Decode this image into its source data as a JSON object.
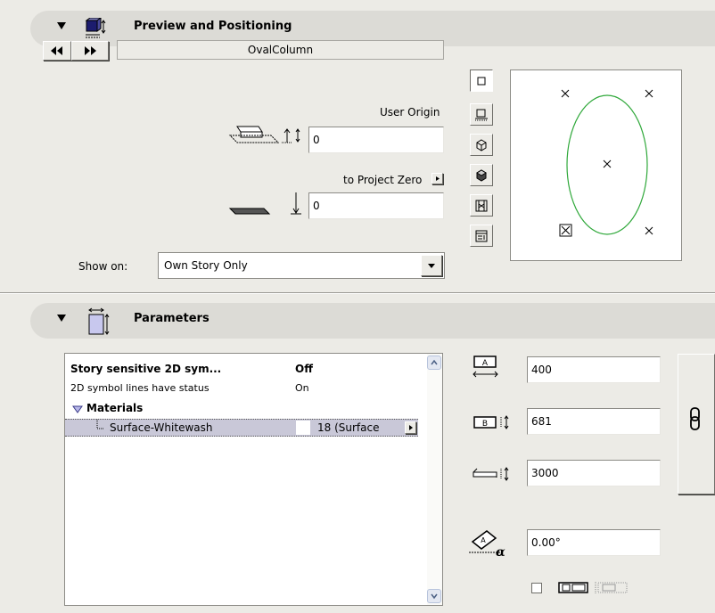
{
  "preview_section": {
    "title": "Preview and Positioning",
    "object_name": "OvalColumn",
    "user_origin_label": "User Origin",
    "user_origin_value": "0",
    "project_zero_label": "to Project Zero",
    "project_zero_value": "0",
    "show_on_label": "Show on:",
    "show_on_value": "Own Story Only"
  },
  "parameters_section": {
    "title": "Parameters",
    "rows": [
      {
        "name": "Story sensitive 2D sym...",
        "value": "Off"
      },
      {
        "name": "2D symbol lines have status",
        "value": "On"
      }
    ],
    "materials_label": "Materials",
    "material_row": {
      "name": "Surface-Whitewash",
      "value": "18 (Surface"
    }
  },
  "dimensions": {
    "width_a": "400",
    "width_b": "681",
    "height": "3000",
    "angle": "0.00°"
  },
  "colors": {
    "oval_stroke": "#2fa83a",
    "selection": "#c9c8d8"
  }
}
